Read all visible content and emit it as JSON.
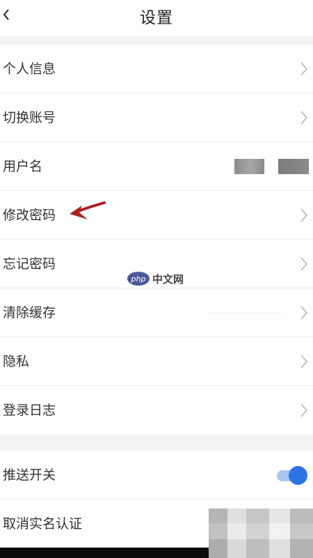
{
  "header": {
    "title": "设置",
    "back_icon": "chevron-left-icon"
  },
  "group1": [
    {
      "label": "个人信息",
      "has_chevron": true
    },
    {
      "label": "切换账号",
      "has_chevron": true
    },
    {
      "label": "用户名",
      "has_chevron": false
    },
    {
      "label": "修改密码",
      "has_chevron": true
    },
    {
      "label": "忘记密码",
      "has_chevron": true
    },
    {
      "label": "清除缓存",
      "has_chevron": true
    },
    {
      "label": "隐私",
      "has_chevron": true
    },
    {
      "label": "登录日志",
      "has_chevron": true
    }
  ],
  "group2": [
    {
      "label": "推送开关",
      "toggle_on": true
    },
    {
      "label": "取消实名认证"
    }
  ],
  "watermark": {
    "logo": "php",
    "text": "中文网"
  },
  "colors": {
    "toggle_accent": "#2d73e6",
    "toggle_track": "#a9c6f2",
    "annotation_arrow": "#b01e1e"
  }
}
